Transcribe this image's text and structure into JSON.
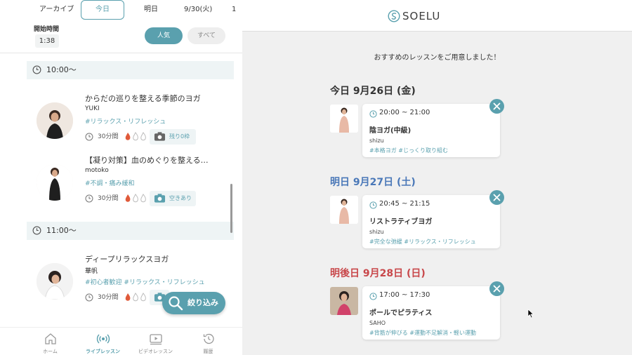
{
  "left": {
    "date_tabs": [
      "アーカイブ",
      "今日",
      "明日",
      "9/30(火)",
      "1"
    ],
    "start_label": "開始時間",
    "start_time": "1:38",
    "filters": {
      "popular": "人気",
      "all": "すべて"
    },
    "slots": [
      {
        "time": "10:00～",
        "lessons": [
          {
            "title": "からだの巡りを整える季節のヨガ",
            "instructor": "YUKI",
            "tags": "#リラックス・リフレッシュ",
            "duration": "30分間",
            "intensity": "♨♨♨",
            "availability": "残り0枠"
          },
          {
            "title": "【凝り対策】血のめぐりを整える…",
            "instructor": "motoko",
            "tags": "#不調・痛み緩和",
            "duration": "30分間",
            "intensity": "♨♨♨",
            "availability": "空きあり"
          }
        ]
      },
      {
        "time": "11:00～",
        "lessons": [
          {
            "title": "ディープリラックスヨガ",
            "instructor": "華帆",
            "tags": "#初心者歓迎 #リラックス・リフレッシュ",
            "duration": "30分間",
            "intensity": "♨♨♨",
            "availability": ""
          }
        ]
      }
    ],
    "filter_button": "絞り込み",
    "nav": [
      {
        "label": "ホーム",
        "icon": "home-icon"
      },
      {
        "label": "ライブレッスン",
        "icon": "live-icon"
      },
      {
        "label": "ビデオレッスン",
        "icon": "video-icon"
      },
      {
        "label": "履歴",
        "icon": "history-icon"
      }
    ],
    "accent_color": "#5aa0ae"
  },
  "right": {
    "logo_text": "SOELU",
    "recommend_text": "おすすめのレッスンをご用意しました！",
    "days": [
      {
        "heading": "今日 9月26日 (金)",
        "time": "20:00 ~ 21:00",
        "title": "陰ヨガ(中級)",
        "instructor": "shizu",
        "tags": "#本格ヨガ #じっくり取り組む"
      },
      {
        "heading": "明日 9月27日 (土)",
        "time": "20:45 ~ 21:15",
        "title": "リストラティブヨガ",
        "instructor": "shizu",
        "tags": "#完全な弛緩 #リラックス・リフレッシュ"
      },
      {
        "heading": "明後日 9月28日 (日)",
        "time": "17:00 ~ 17:30",
        "title": "ポールでピラティス",
        "instructor": "SAHO",
        "tags": "#背筋が伸びる #運動不足解消・軽い運動"
      }
    ],
    "colors": {
      "today": "#333333",
      "tomorrow": "#4a78b8",
      "dayafter": "#c8474a"
    }
  }
}
